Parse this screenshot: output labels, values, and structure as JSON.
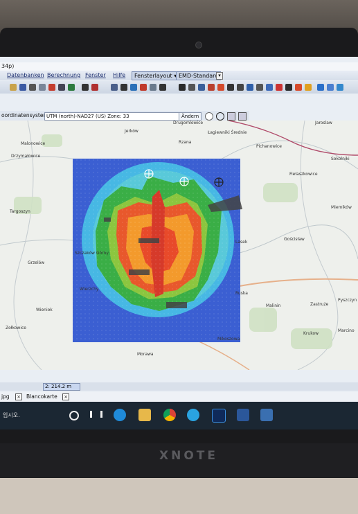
{
  "window": {
    "title": "34p)"
  },
  "menu": {
    "items": [
      "Datenbanken",
      "Berechnung",
      "Fenster",
      "Hilfe"
    ],
    "layout_tab": "Fensterlayout",
    "layout_arrow": "▾",
    "profile": "EMD-Standard",
    "profile_close": "▾"
  },
  "coord": {
    "label": "oordinatensystem",
    "value": "UTM (north)-NAD27 (US) Zone: 33",
    "change": "Ändern"
  },
  "map": {
    "places": [
      "Drugomlowice",
      "Jaroslaw",
      "Jerków",
      "Łagiewniki Średnie",
      "Malonowice",
      "Rzana",
      "Pichanowice",
      "Drzymałowice",
      "Sokolniki",
      "Fiełaszkowice",
      "Targoszyn",
      "Miemików",
      "Gościsław",
      "Lasek",
      "Grzelów",
      "Szczaków Górny",
      "Ruska",
      "Wierzchy",
      "Malinin",
      "Zastruże",
      "Pyszczyn",
      "Wieniok",
      "Zołkowice",
      "Krukow",
      "Marcino",
      "Mikoszowa",
      "Morawa"
    ]
  },
  "status": {
    "scale": "2: 214.2 m"
  },
  "doctabs": [
    {
      "label": "jpg"
    },
    {
      "label": "Blancokarte"
    }
  ],
  "taskbar": {
    "search_hint": "입시오."
  },
  "hardware": {
    "brand": "XNOTE"
  },
  "colors": {
    "ui_blue": "#1b2d6e",
    "heat_red": "#e23a2a",
    "heat_orange": "#f39a2c",
    "heat_green": "#37b34a",
    "heat_cyan": "#48c8e0",
    "heat_blue": "#3f6fd8"
  }
}
